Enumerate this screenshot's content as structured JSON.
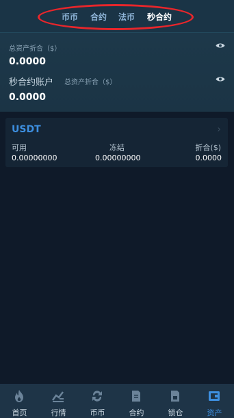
{
  "tabs": [
    {
      "label": "币币"
    },
    {
      "label": "合约"
    },
    {
      "label": "法币"
    },
    {
      "label": "秒合约",
      "active": true
    }
  ],
  "summary": {
    "total_label": "总资产折合（$）",
    "total_value": "0.0000",
    "account_title": "秒合约账户",
    "account_sub_label": "总资产折合（$）",
    "account_value": "0.0000"
  },
  "asset_card": {
    "name": "USDT",
    "available_label": "可用",
    "available_value": "0.00000000",
    "frozen_label": "冻结",
    "frozen_value": "0.00000000",
    "converted_label": "折合($)",
    "converted_value": "0.0000"
  },
  "bottom_nav": [
    {
      "label": "首页",
      "icon": "fire-icon"
    },
    {
      "label": "行情",
      "icon": "chart-icon"
    },
    {
      "label": "币币",
      "icon": "exchange-icon"
    },
    {
      "label": "合约",
      "icon": "document-icon"
    },
    {
      "label": "锁仓",
      "icon": "lock-document-icon"
    },
    {
      "label": "资产",
      "icon": "wallet-icon",
      "active": true
    }
  ],
  "colors": {
    "accent": "#3d8fe0",
    "highlight_ring": "#e8262b",
    "background": "#0f1a29",
    "header": "#1e3a4c"
  }
}
